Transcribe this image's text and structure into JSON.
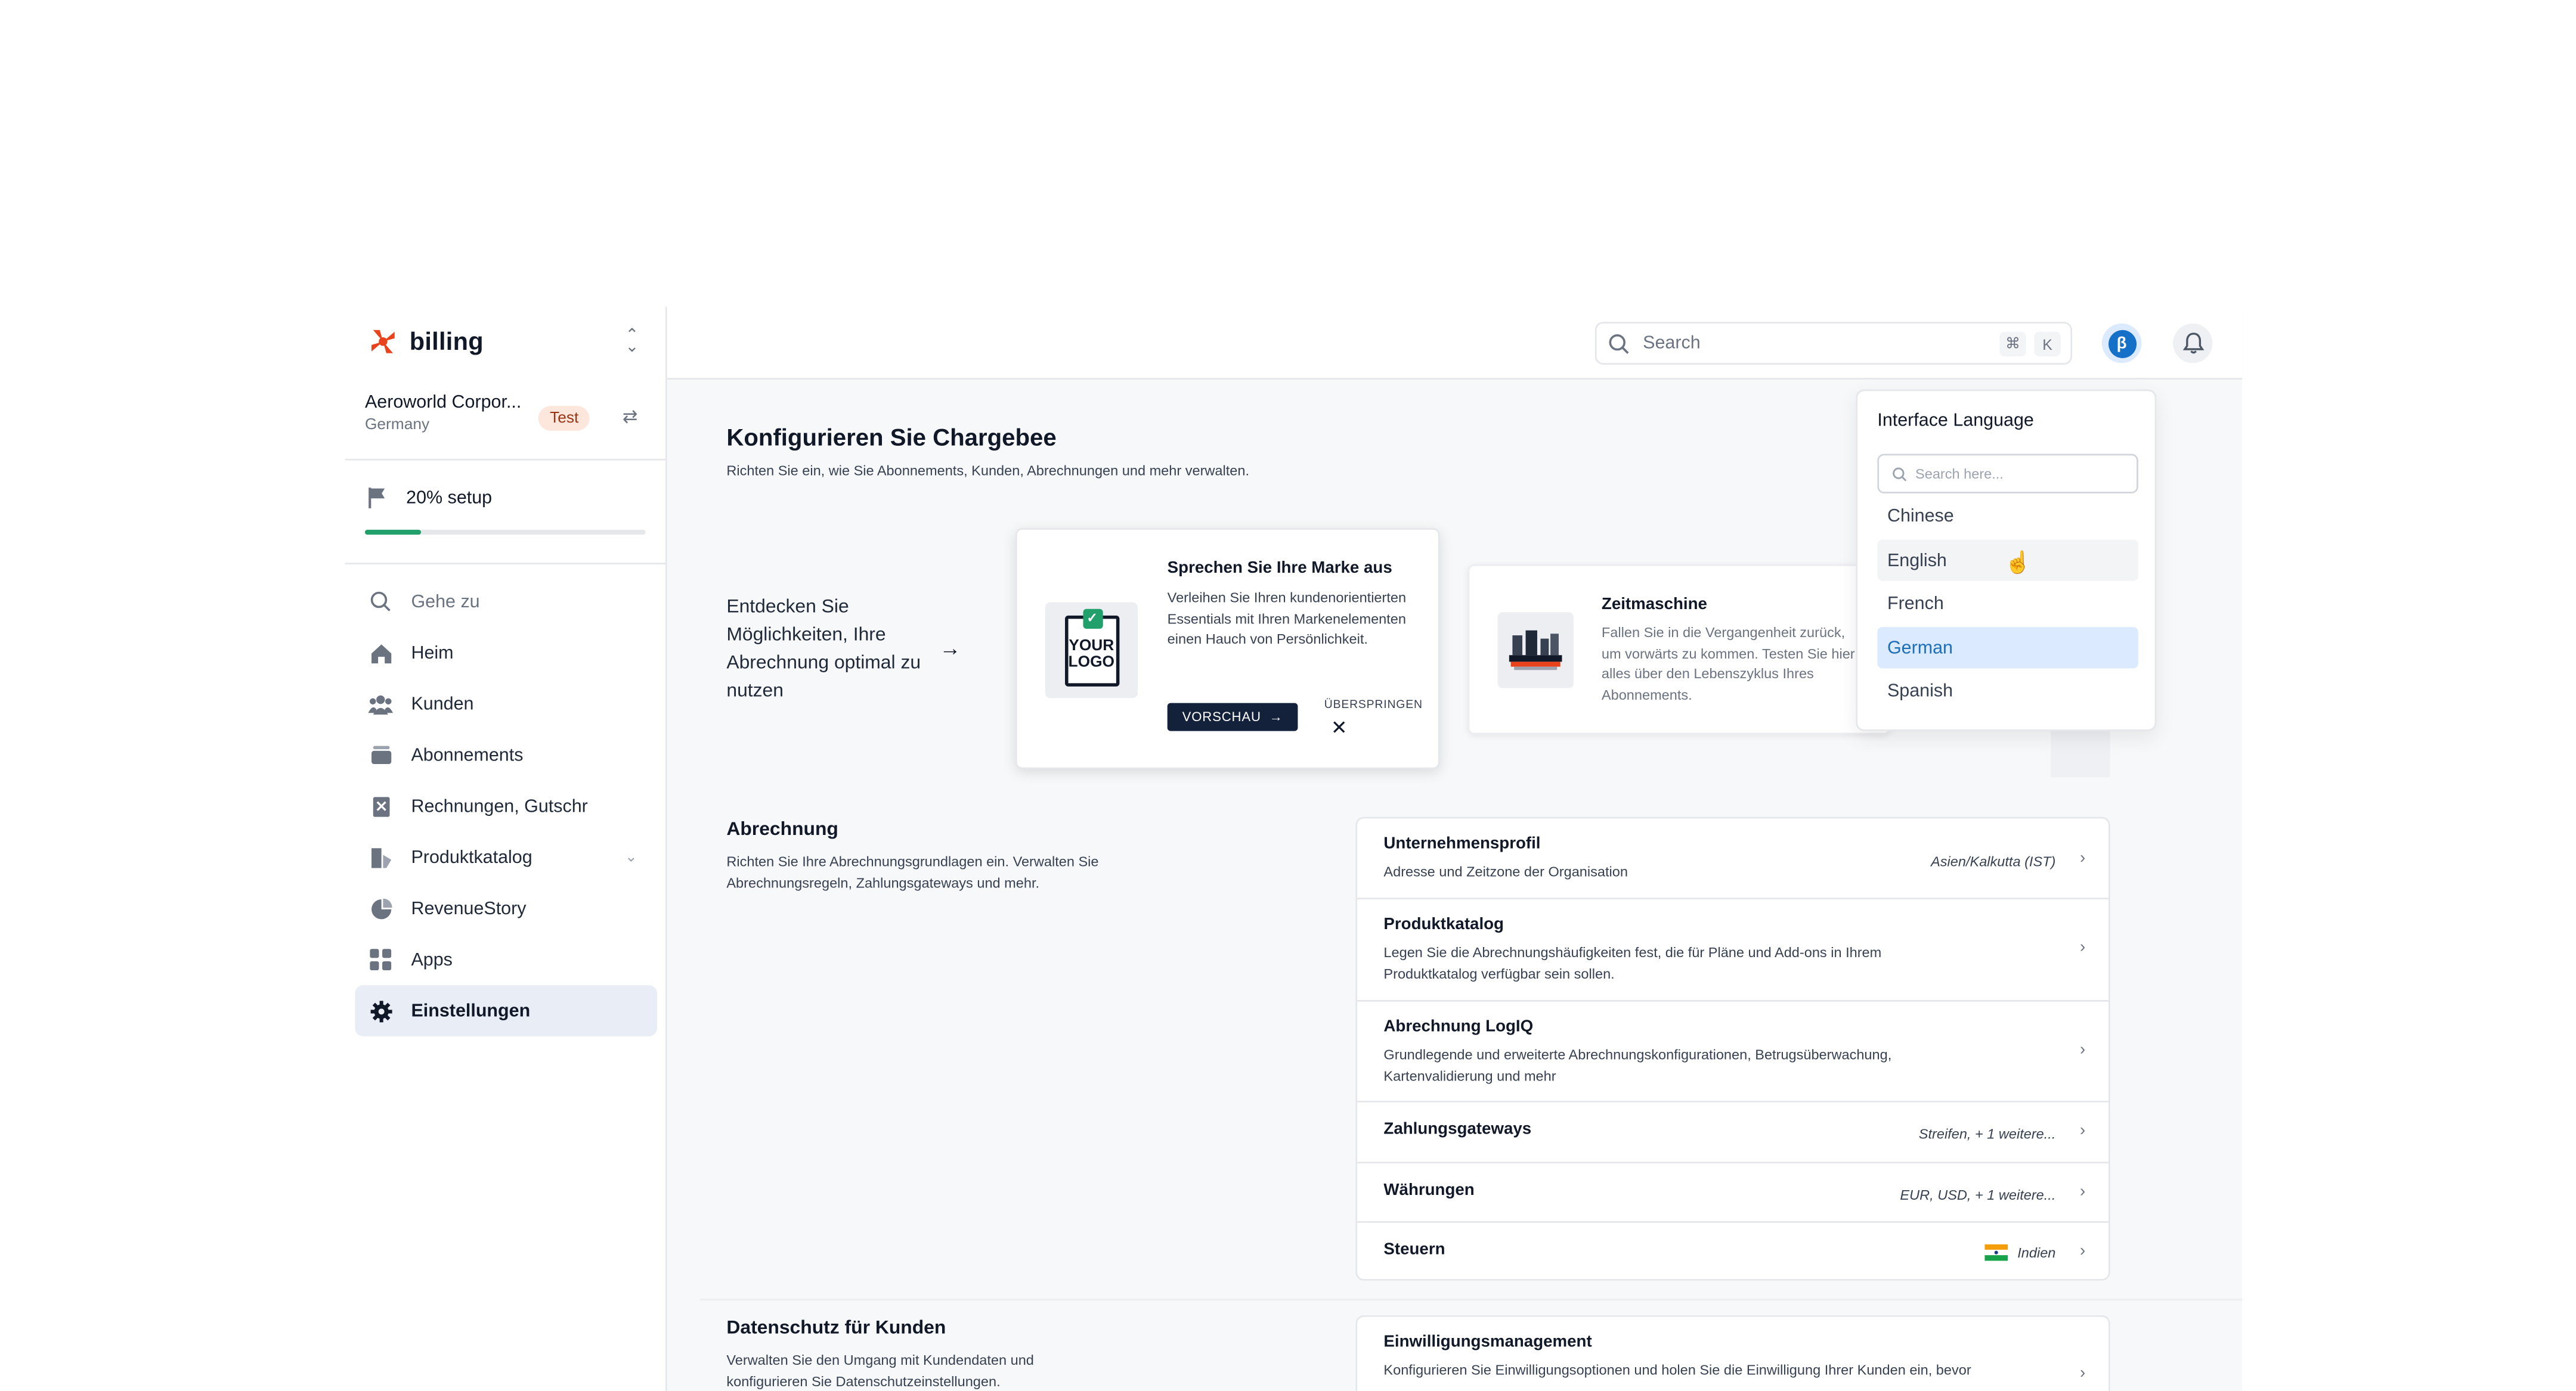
{
  "brand": {
    "name": "billing",
    "accent": "#e8431d"
  },
  "org": {
    "name": "Aeroworld Corpor...",
    "country": "Germany",
    "badge": "Test"
  },
  "setup": {
    "label": "20% setup",
    "progress_fraction": 0.2
  },
  "nav": {
    "goto": "Gehe zu",
    "items": [
      {
        "label": "Heim",
        "icon": "home-icon"
      },
      {
        "label": "Kunden",
        "icon": "customers-icon"
      },
      {
        "label": "Abonnements",
        "icon": "subscriptions-icon"
      },
      {
        "label": "Rechnungen, Gutschr",
        "icon": "invoice-icon"
      },
      {
        "label": "Produktkatalog",
        "icon": "catalog-icon"
      },
      {
        "label": "RevenueStory",
        "icon": "pie-chart-icon"
      },
      {
        "label": "Apps",
        "icon": "apps-grid-icon"
      },
      {
        "label": "Einstellungen",
        "icon": "gear-icon"
      }
    ]
  },
  "topbar": {
    "search_placeholder": "Search",
    "shortcut_cmd": "⌘",
    "shortcut_key": "K",
    "beta_label": "β"
  },
  "main": {
    "title": "Konfigurieren Sie Chargebee",
    "subtitle": "Richten Sie ein, wie Sie Abonnements, Kunden, Abrechnungen und mehr verwalten.",
    "discover": "Entdecken Sie Möglichkeiten, Ihre Abrechnung optimal zu nutzen"
  },
  "cards": {
    "brand": {
      "logo_line1": "YOUR",
      "logo_line2": "LOGO",
      "title": "Sprechen Sie Ihre Marke aus",
      "text": "Verleihen Sie Ihren kundenorientierten Essentials mit Ihren Markenelementen einen Hauch von Persönlichkeit.",
      "preview": "VORSCHAU",
      "skip": "ÜBERSPRINGEN"
    },
    "time": {
      "title": "Zeitmaschine",
      "text": "Fallen Sie in die Vergangenheit zurück, um vorwärts zu kommen. Testen Sie hier alles über den Lebenszyklus Ihres Abonnements."
    }
  },
  "billing_section": {
    "title": "Abrechnung",
    "desc": "Richten Sie Ihre Abrechnungsgrundlagen ein. Verwalten Sie Abrechnungsregeln, Zahlungsgateways und mehr.",
    "rows": [
      {
        "title": "Unternehmensprofil",
        "desc": "Adresse und Zeitzone der Organisation",
        "value": "Asien/Kalkutta (IST)"
      },
      {
        "title": "Produktkatalog",
        "desc": "Legen Sie die Abrechnungshäufigkeiten fest, die für Pläne und Add-ons in Ihrem Produktkatalog verfügbar sein sollen.",
        "value": ""
      },
      {
        "title": "Abrechnung LogIQ",
        "desc": "Grundlegende und erweiterte Abrechnungskonfigurationen, Betrugsüberwachung, Kartenvalidierung und mehr",
        "value": ""
      },
      {
        "title": "Zahlungsgateways",
        "desc": "",
        "value": "Streifen, + 1 weitere..."
      },
      {
        "title": "Währungen",
        "desc": "",
        "value": "EUR, USD, + 1 weitere..."
      },
      {
        "title": "Steuern",
        "desc": "",
        "value": "Indien"
      }
    ]
  },
  "privacy_section": {
    "title": "Datenschutz für Kunden",
    "desc": "Verwalten Sie den Umgang mit Kundendaten und konfigurieren Sie Datenschutzeinstellungen.",
    "row": {
      "title": "Einwilligungsmanagement",
      "desc": "Konfigurieren Sie Einwilligungsoptionen und holen Sie die Einwilligung Ihrer Kunden ein, bevor"
    }
  },
  "language_dropdown": {
    "title": "Interface Language",
    "search_placeholder": "Search here...",
    "options": [
      "Chinese",
      "English",
      "French",
      "German",
      "Spanish"
    ],
    "selected": "German",
    "hovered": "English"
  },
  "colors": {
    "selected_bg": "#dbeafe",
    "primary_blue": "#1570c7",
    "progress_green": "#22a06b"
  }
}
